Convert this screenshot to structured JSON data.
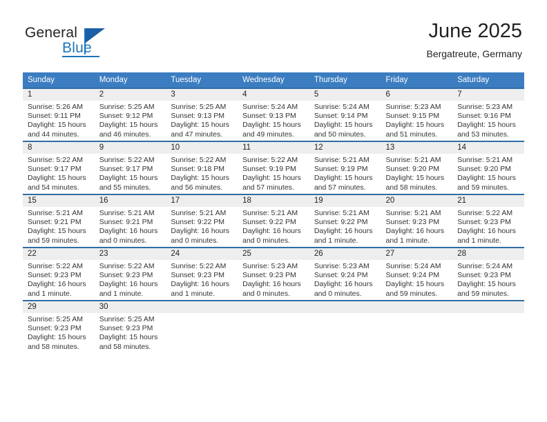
{
  "brand": {
    "name_part1": "General",
    "name_part2": "Blue",
    "accent_color": "#1b75bb",
    "triangle_color": "#1b5fa6"
  },
  "header": {
    "month_title": "June 2025",
    "location": "Bergatreute, Germany"
  },
  "calendar": {
    "header_bg": "#3b7dc0",
    "row_border_color": "#2e6da4",
    "daynum_band_color": "#eeeeee",
    "weekday_headers": [
      "Sunday",
      "Monday",
      "Tuesday",
      "Wednesday",
      "Thursday",
      "Friday",
      "Saturday"
    ],
    "weeks": [
      [
        {
          "day": "1",
          "sunrise": "Sunrise: 5:26 AM",
          "sunset": "Sunset: 9:11 PM",
          "daylight_line1": "Daylight: 15 hours",
          "daylight_line2": "and 44 minutes."
        },
        {
          "day": "2",
          "sunrise": "Sunrise: 5:25 AM",
          "sunset": "Sunset: 9:12 PM",
          "daylight_line1": "Daylight: 15 hours",
          "daylight_line2": "and 46 minutes."
        },
        {
          "day": "3",
          "sunrise": "Sunrise: 5:25 AM",
          "sunset": "Sunset: 9:13 PM",
          "daylight_line1": "Daylight: 15 hours",
          "daylight_line2": "and 47 minutes."
        },
        {
          "day": "4",
          "sunrise": "Sunrise: 5:24 AM",
          "sunset": "Sunset: 9:13 PM",
          "daylight_line1": "Daylight: 15 hours",
          "daylight_line2": "and 49 minutes."
        },
        {
          "day": "5",
          "sunrise": "Sunrise: 5:24 AM",
          "sunset": "Sunset: 9:14 PM",
          "daylight_line1": "Daylight: 15 hours",
          "daylight_line2": "and 50 minutes."
        },
        {
          "day": "6",
          "sunrise": "Sunrise: 5:23 AM",
          "sunset": "Sunset: 9:15 PM",
          "daylight_line1": "Daylight: 15 hours",
          "daylight_line2": "and 51 minutes."
        },
        {
          "day": "7",
          "sunrise": "Sunrise: 5:23 AM",
          "sunset": "Sunset: 9:16 PM",
          "daylight_line1": "Daylight: 15 hours",
          "daylight_line2": "and 53 minutes."
        }
      ],
      [
        {
          "day": "8",
          "sunrise": "Sunrise: 5:22 AM",
          "sunset": "Sunset: 9:17 PM",
          "daylight_line1": "Daylight: 15 hours",
          "daylight_line2": "and 54 minutes."
        },
        {
          "day": "9",
          "sunrise": "Sunrise: 5:22 AM",
          "sunset": "Sunset: 9:17 PM",
          "daylight_line1": "Daylight: 15 hours",
          "daylight_line2": "and 55 minutes."
        },
        {
          "day": "10",
          "sunrise": "Sunrise: 5:22 AM",
          "sunset": "Sunset: 9:18 PM",
          "daylight_line1": "Daylight: 15 hours",
          "daylight_line2": "and 56 minutes."
        },
        {
          "day": "11",
          "sunrise": "Sunrise: 5:22 AM",
          "sunset": "Sunset: 9:19 PM",
          "daylight_line1": "Daylight: 15 hours",
          "daylight_line2": "and 57 minutes."
        },
        {
          "day": "12",
          "sunrise": "Sunrise: 5:21 AM",
          "sunset": "Sunset: 9:19 PM",
          "daylight_line1": "Daylight: 15 hours",
          "daylight_line2": "and 57 minutes."
        },
        {
          "day": "13",
          "sunrise": "Sunrise: 5:21 AM",
          "sunset": "Sunset: 9:20 PM",
          "daylight_line1": "Daylight: 15 hours",
          "daylight_line2": "and 58 minutes."
        },
        {
          "day": "14",
          "sunrise": "Sunrise: 5:21 AM",
          "sunset": "Sunset: 9:20 PM",
          "daylight_line1": "Daylight: 15 hours",
          "daylight_line2": "and 59 minutes."
        }
      ],
      [
        {
          "day": "15",
          "sunrise": "Sunrise: 5:21 AM",
          "sunset": "Sunset: 9:21 PM",
          "daylight_line1": "Daylight: 15 hours",
          "daylight_line2": "and 59 minutes."
        },
        {
          "day": "16",
          "sunrise": "Sunrise: 5:21 AM",
          "sunset": "Sunset: 9:21 PM",
          "daylight_line1": "Daylight: 16 hours",
          "daylight_line2": "and 0 minutes."
        },
        {
          "day": "17",
          "sunrise": "Sunrise: 5:21 AM",
          "sunset": "Sunset: 9:22 PM",
          "daylight_line1": "Daylight: 16 hours",
          "daylight_line2": "and 0 minutes."
        },
        {
          "day": "18",
          "sunrise": "Sunrise: 5:21 AM",
          "sunset": "Sunset: 9:22 PM",
          "daylight_line1": "Daylight: 16 hours",
          "daylight_line2": "and 0 minutes."
        },
        {
          "day": "19",
          "sunrise": "Sunrise: 5:21 AM",
          "sunset": "Sunset: 9:22 PM",
          "daylight_line1": "Daylight: 16 hours",
          "daylight_line2": "and 1 minute."
        },
        {
          "day": "20",
          "sunrise": "Sunrise: 5:21 AM",
          "sunset": "Sunset: 9:23 PM",
          "daylight_line1": "Daylight: 16 hours",
          "daylight_line2": "and 1 minute."
        },
        {
          "day": "21",
          "sunrise": "Sunrise: 5:22 AM",
          "sunset": "Sunset: 9:23 PM",
          "daylight_line1": "Daylight: 16 hours",
          "daylight_line2": "and 1 minute."
        }
      ],
      [
        {
          "day": "22",
          "sunrise": "Sunrise: 5:22 AM",
          "sunset": "Sunset: 9:23 PM",
          "daylight_line1": "Daylight: 16 hours",
          "daylight_line2": "and 1 minute."
        },
        {
          "day": "23",
          "sunrise": "Sunrise: 5:22 AM",
          "sunset": "Sunset: 9:23 PM",
          "daylight_line1": "Daylight: 16 hours",
          "daylight_line2": "and 1 minute."
        },
        {
          "day": "24",
          "sunrise": "Sunrise: 5:22 AM",
          "sunset": "Sunset: 9:23 PM",
          "daylight_line1": "Daylight: 16 hours",
          "daylight_line2": "and 1 minute."
        },
        {
          "day": "25",
          "sunrise": "Sunrise: 5:23 AM",
          "sunset": "Sunset: 9:23 PM",
          "daylight_line1": "Daylight: 16 hours",
          "daylight_line2": "and 0 minutes."
        },
        {
          "day": "26",
          "sunrise": "Sunrise: 5:23 AM",
          "sunset": "Sunset: 9:24 PM",
          "daylight_line1": "Daylight: 16 hours",
          "daylight_line2": "and 0 minutes."
        },
        {
          "day": "27",
          "sunrise": "Sunrise: 5:24 AM",
          "sunset": "Sunset: 9:24 PM",
          "daylight_line1": "Daylight: 15 hours",
          "daylight_line2": "and 59 minutes."
        },
        {
          "day": "28",
          "sunrise": "Sunrise: 5:24 AM",
          "sunset": "Sunset: 9:23 PM",
          "daylight_line1": "Daylight: 15 hours",
          "daylight_line2": "and 59 minutes."
        }
      ],
      [
        {
          "day": "29",
          "sunrise": "Sunrise: 5:25 AM",
          "sunset": "Sunset: 9:23 PM",
          "daylight_line1": "Daylight: 15 hours",
          "daylight_line2": "and 58 minutes."
        },
        {
          "day": "30",
          "sunrise": "Sunrise: 5:25 AM",
          "sunset": "Sunset: 9:23 PM",
          "daylight_line1": "Daylight: 15 hours",
          "daylight_line2": "and 58 minutes."
        },
        {
          "day": "",
          "sunrise": "",
          "sunset": "",
          "daylight_line1": "",
          "daylight_line2": ""
        },
        {
          "day": "",
          "sunrise": "",
          "sunset": "",
          "daylight_line1": "",
          "daylight_line2": ""
        },
        {
          "day": "",
          "sunrise": "",
          "sunset": "",
          "daylight_line1": "",
          "daylight_line2": ""
        },
        {
          "day": "",
          "sunrise": "",
          "sunset": "",
          "daylight_line1": "",
          "daylight_line2": ""
        },
        {
          "day": "",
          "sunrise": "",
          "sunset": "",
          "daylight_line1": "",
          "daylight_line2": ""
        }
      ]
    ]
  }
}
